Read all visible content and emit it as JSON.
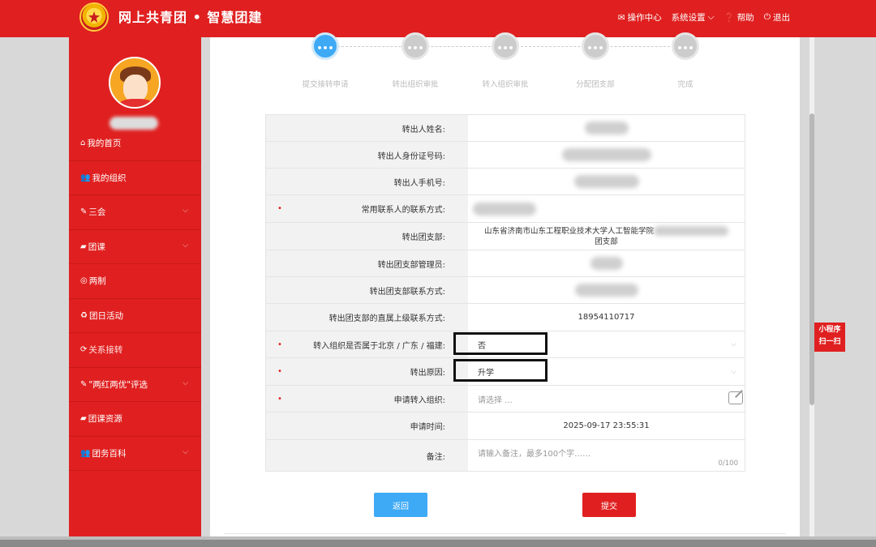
{
  "header": {
    "brand": "网上共青团 • 智慧团建",
    "menu": [
      {
        "icon": "mail-icon",
        "label": "操作中心"
      },
      {
        "icon": "",
        "label": "系统设置"
      },
      {
        "icon": "help-icon",
        "label": "帮助"
      },
      {
        "icon": "power-icon",
        "label": "退出"
      }
    ]
  },
  "sidebar": {
    "items": [
      {
        "icon": "home-icon",
        "label": "我的首页",
        "expandable": false
      },
      {
        "icon": "users-icon",
        "label": "我的组织",
        "expandable": false
      },
      {
        "icon": "edit-icon",
        "label": "三会",
        "expandable": true
      },
      {
        "icon": "folder-icon",
        "label": "团课",
        "expandable": true
      },
      {
        "icon": "target-icon",
        "label": "两制",
        "expandable": false
      },
      {
        "icon": "recycle-icon",
        "label": "团日活动",
        "expandable": false
      },
      {
        "icon": "refresh-icon",
        "label": "关系接转",
        "expandable": false
      },
      {
        "icon": "edit-icon",
        "label": "\"两红两优\"评选",
        "expandable": true
      },
      {
        "icon": "folder-icon",
        "label": "团课资源",
        "expandable": false
      },
      {
        "icon": "users-icon",
        "label": "团务百科",
        "expandable": true
      }
    ]
  },
  "steps": [
    {
      "label": "提交接转申请",
      "active": true,
      "symbol": "•••"
    },
    {
      "label": "转出组织审批",
      "active": false,
      "symbol": "•••"
    },
    {
      "label": "转入组织审批",
      "active": false,
      "symbol": "•••"
    },
    {
      "label": "分配团支部",
      "active": false,
      "symbol": "•••"
    },
    {
      "label": "完成",
      "active": false,
      "symbol": "•••"
    }
  ],
  "form": {
    "transferor_name_label": "转出人姓名:",
    "id_number_label": "转出人身份证号码:",
    "phone_label": "转出人手机号:",
    "contact_label": "常用联系人的联系方式:",
    "branch_label": "转出团支部:",
    "branch_value": "山东省济南市山东工程职业技术大学人工智能学院",
    "branch_value_tail": "团支部",
    "branch_admin_label": "转出团支部管理员:",
    "branch_contact_label": "转出团支部联系方式:",
    "superior_contact_label": "转出团支部的直属上级联系方式:",
    "superior_contact_value": "18954110717",
    "region_label": "转入组织是否属于北京 / 广东 / 福建:",
    "region_value": "否",
    "reason_label": "转出原因:",
    "reason_value": "升学",
    "target_org_label": "申请转入组织:",
    "target_org_placeholder": "请选择 ...",
    "apply_time_label": "申请时间:",
    "apply_time_value": "2025-09-17 23:55:31",
    "remark_label": "备注:",
    "remark_placeholder": "请输入备注，最多100个字……",
    "remark_counter": "0/100"
  },
  "buttons": {
    "back": "返回",
    "submit": "提交"
  },
  "side_badge": {
    "line1": "小程序",
    "line2": "扫一扫"
  },
  "colors": {
    "brand_red": "#e02020",
    "accent_blue": "#3ea9f5"
  }
}
